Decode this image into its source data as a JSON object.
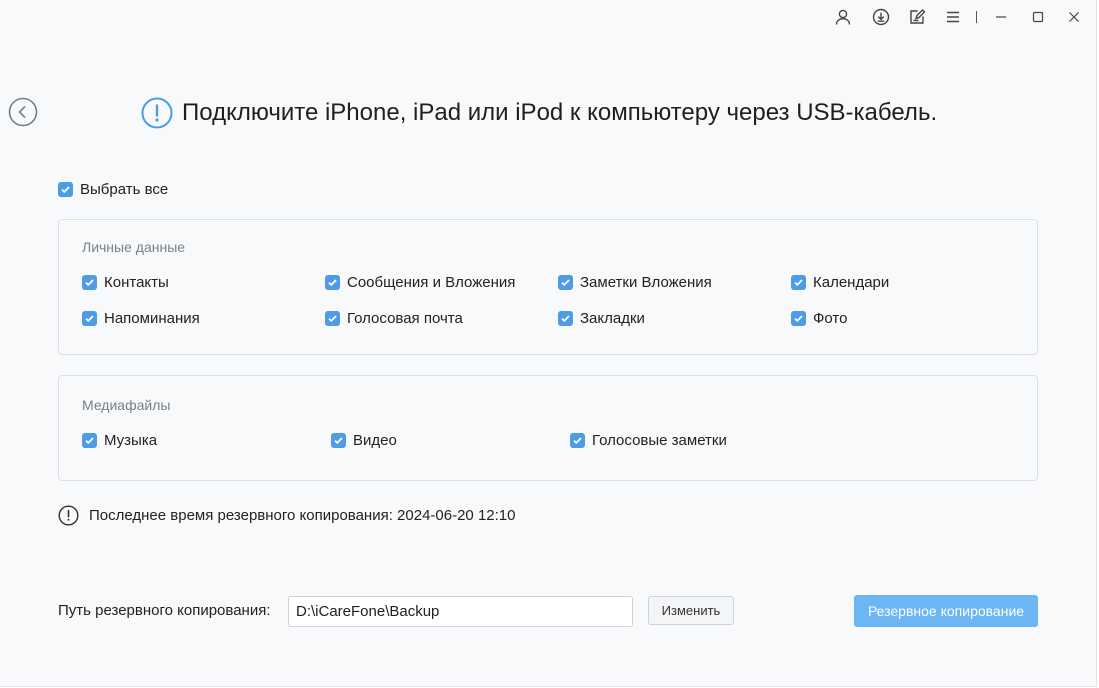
{
  "colors": {
    "accent": "#4e9be8",
    "backup_button": "#6cb6f3",
    "info_icon": "#4e9be8",
    "window_bg": "#f8f9fb"
  },
  "titlebar": {
    "icons": [
      "user-icon",
      "download-icon",
      "edit-icon",
      "menu-icon",
      "minimize-icon",
      "maximize-icon",
      "close-icon"
    ]
  },
  "header": {
    "text": "Подключите iPhone, iPad или iPod к компьютеру через USB-кабель."
  },
  "select_all": {
    "label": "Выбрать все",
    "checked": true
  },
  "personal": {
    "title": "Личные данные",
    "items": [
      {
        "label": "Контакты",
        "checked": true
      },
      {
        "label": "Сообщения и Вложения",
        "checked": true
      },
      {
        "label": "Заметки Вложения",
        "checked": true
      },
      {
        "label": "Календари",
        "checked": true
      },
      {
        "label": "Напоминания",
        "checked": true
      },
      {
        "label": "Голосовая почта",
        "checked": true
      },
      {
        "label": "Закладки",
        "checked": true
      },
      {
        "label": "Фото",
        "checked": true
      }
    ]
  },
  "media": {
    "title": "Медиафайлы",
    "items": [
      {
        "label": "Музыка",
        "checked": true
      },
      {
        "label": "Видео",
        "checked": true
      },
      {
        "label": "Голосовые заметки",
        "checked": true
      }
    ]
  },
  "notice": {
    "text": "Последнее время резервного копирования: 2024-06-20 12:10"
  },
  "path": {
    "label": "Путь резервного копирования:",
    "value": "D:\\iCareFone\\Backup",
    "change_label": "Изменить"
  },
  "backup_button": {
    "label": "Резервное копирование"
  }
}
